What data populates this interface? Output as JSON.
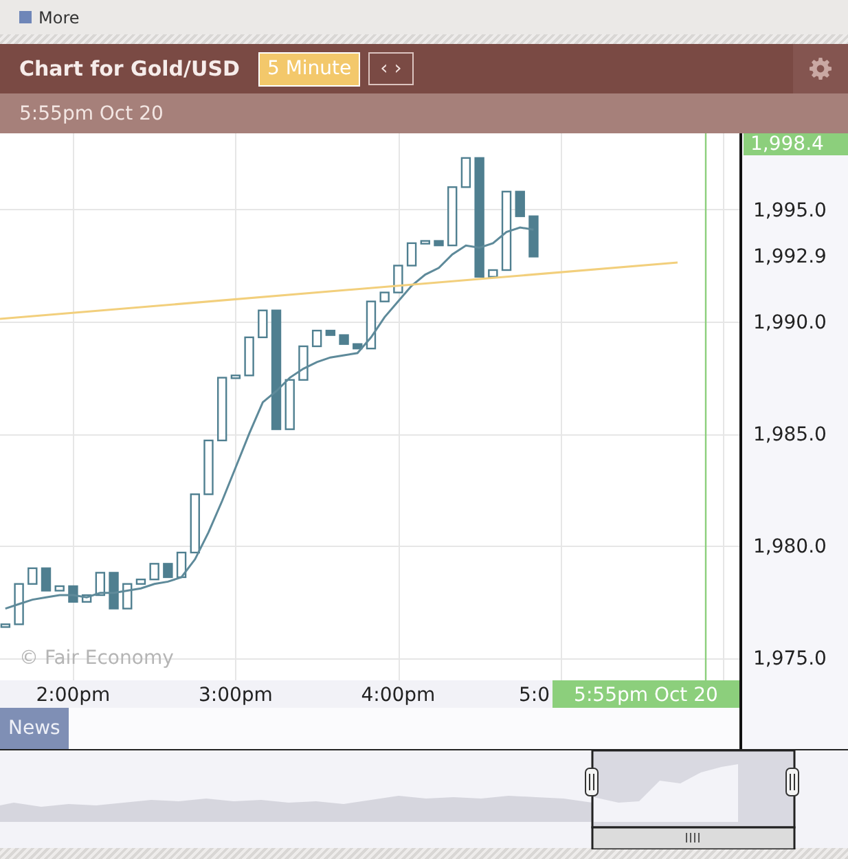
{
  "top_bar": {
    "link": "More"
  },
  "header": {
    "title": "Chart for Gold/USD",
    "timeframe": "5 Minute",
    "nav": "‹ ›",
    "subtitle": "5:55pm Oct 20"
  },
  "chart": {
    "credit": "© Fair Economy",
    "news_tab": "News",
    "time_axis": [
      "2:00pm",
      "3:00pm",
      "4:00pm",
      "5:0"
    ],
    "price_axis": [
      "1,995.0",
      "1,990.0",
      "1,985.0",
      "1,980.0",
      "1,975.0"
    ],
    "time_marker": {
      "label": "5:55pm Oct 20"
    },
    "high_tag": {
      "label": "1,998.4"
    },
    "last_price": {
      "label": "1,992.9"
    }
  }
}
